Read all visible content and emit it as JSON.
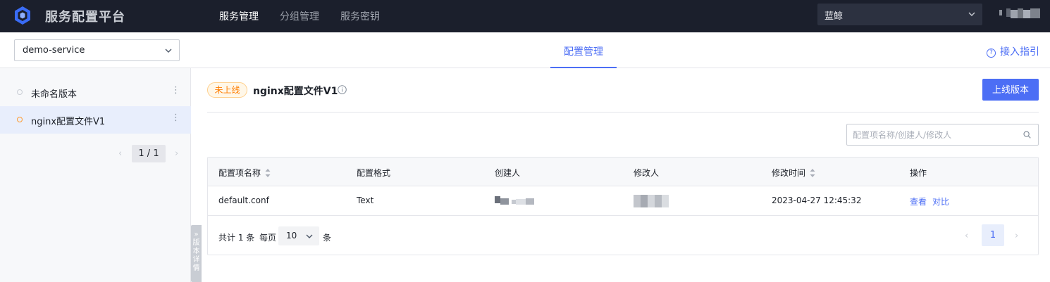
{
  "app": {
    "title": "服务配置平台",
    "logo": "hexagon-logo-icon"
  },
  "nav": [
    {
      "label": "服务管理",
      "active": true
    },
    {
      "label": "分组管理",
      "active": false
    },
    {
      "label": "服务密钥",
      "active": false
    }
  ],
  "team_select": {
    "value": "蓝鲸"
  },
  "service_select": {
    "value": "demo-service"
  },
  "center_tab": {
    "label": "配置管理"
  },
  "guide": {
    "label": "接入指引",
    "icon": "question-circle-icon"
  },
  "sidebar": {
    "versions": [
      {
        "label": "未命名版本",
        "status_color": "#c9cdd4",
        "more": "⋮"
      },
      {
        "label": "nginx配置文件V1",
        "status_color": "#ff9a2e",
        "more": "⋮"
      }
    ],
    "pager": {
      "prev": "‹",
      "text": "1 / 1",
      "next": "›"
    },
    "detail_tab": {
      "arrow": "»",
      "label": "版本详情"
    }
  },
  "main": {
    "status_badge": "未上线",
    "title": "nginx配置文件V1",
    "publish_button": "上线版本",
    "search": {
      "placeholder": "配置项名称/创建人/修改人"
    },
    "table": {
      "columns": [
        {
          "label": "配置项名称",
          "sortable": true
        },
        {
          "label": "配置格式",
          "sortable": false
        },
        {
          "label": "创建人",
          "sortable": false
        },
        {
          "label": "修改人",
          "sortable": false
        },
        {
          "label": "修改时间",
          "sortable": true
        },
        {
          "label": "操作",
          "sortable": false
        }
      ],
      "rows": [
        {
          "name": "default.conf",
          "format": "Text",
          "creator": "",
          "modifier": "",
          "modified_time": "2023-04-27 12:45:32",
          "actions": [
            "查看",
            "对比"
          ]
        }
      ]
    },
    "footer": {
      "total": "共计 1 条",
      "per_page_label": "每页",
      "per_page_value": "10",
      "unit": "条",
      "prev": "‹",
      "current_page": "1",
      "next": "›"
    }
  },
  "colors": {
    "topbar": "#1b1f2c",
    "accent": "#4c6ef5",
    "warning": "#ff7d00"
  }
}
